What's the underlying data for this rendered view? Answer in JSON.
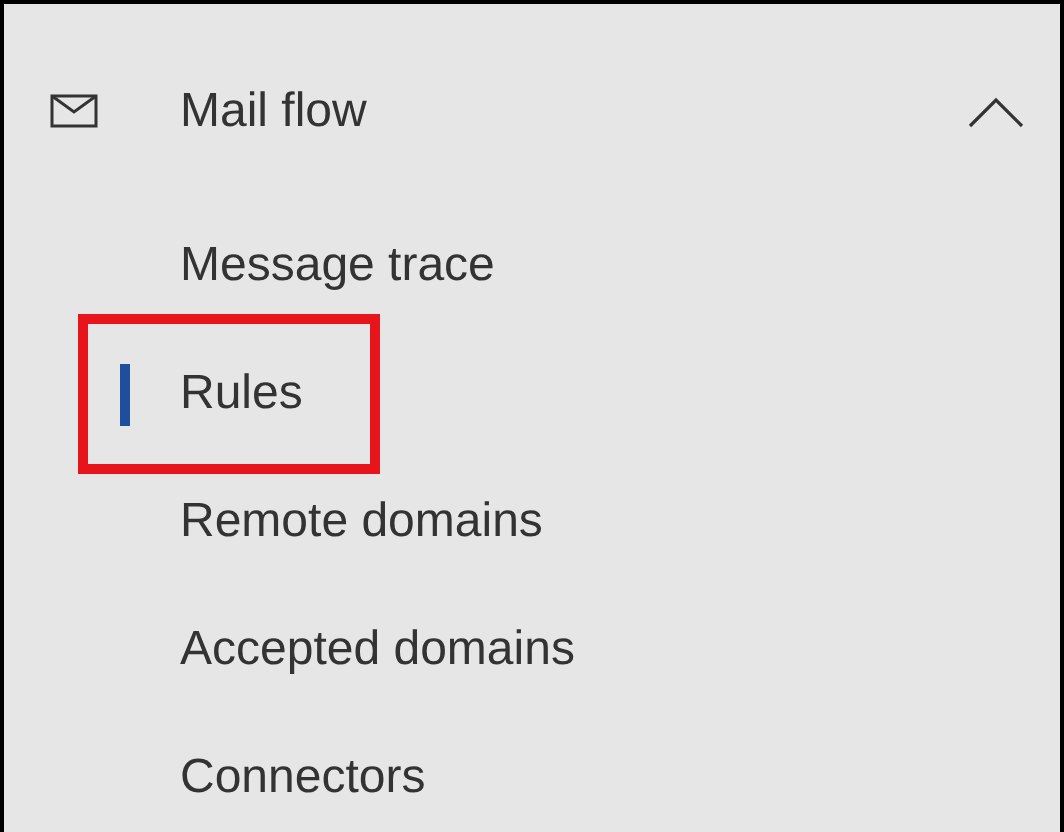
{
  "nav_group": {
    "title": "Mail flow",
    "expanded": true,
    "items": [
      {
        "label": "Message trace",
        "selected": false,
        "highlighted": false
      },
      {
        "label": "Rules",
        "selected": true,
        "highlighted": true
      },
      {
        "label": "Remote domains",
        "selected": false,
        "highlighted": false
      },
      {
        "label": "Accepted domains",
        "selected": false,
        "highlighted": false
      },
      {
        "label": "Connectors",
        "selected": false,
        "highlighted": false
      }
    ]
  }
}
